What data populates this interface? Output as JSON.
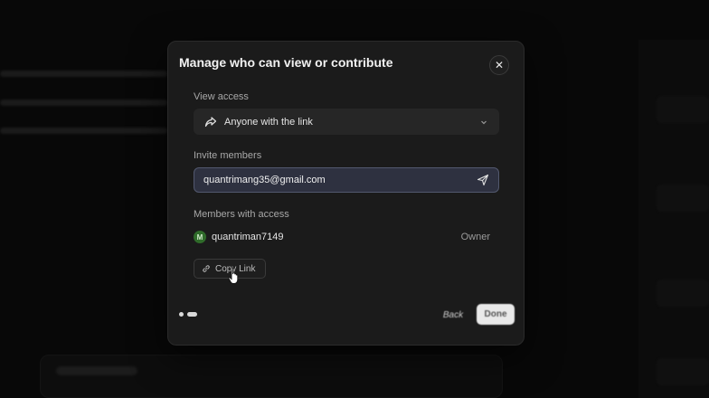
{
  "modal": {
    "title": "Manage who can view or contribute",
    "close_symbol": "✕",
    "view_access": {
      "label": "View access",
      "selected_option": "Anyone with the link",
      "icon": "share-icon"
    },
    "invite": {
      "label": "Invite members",
      "value": "quantrimang35@gmail.com",
      "send_icon": "send-icon"
    },
    "members": {
      "label": "Members with access",
      "list": [
        {
          "avatar_initial": "M",
          "name": "quantriman7149",
          "role": "Owner"
        }
      ]
    },
    "copy_link_label": "Copy Link",
    "footer": {
      "back_label": "Back",
      "done_label": "Done"
    }
  },
  "colors": {
    "modal_bg": "#1b1b1b",
    "input_bg": "#2e3140",
    "avatar_bg": "#2f6b2a",
    "primary_button_bg": "#e9e9e9"
  }
}
